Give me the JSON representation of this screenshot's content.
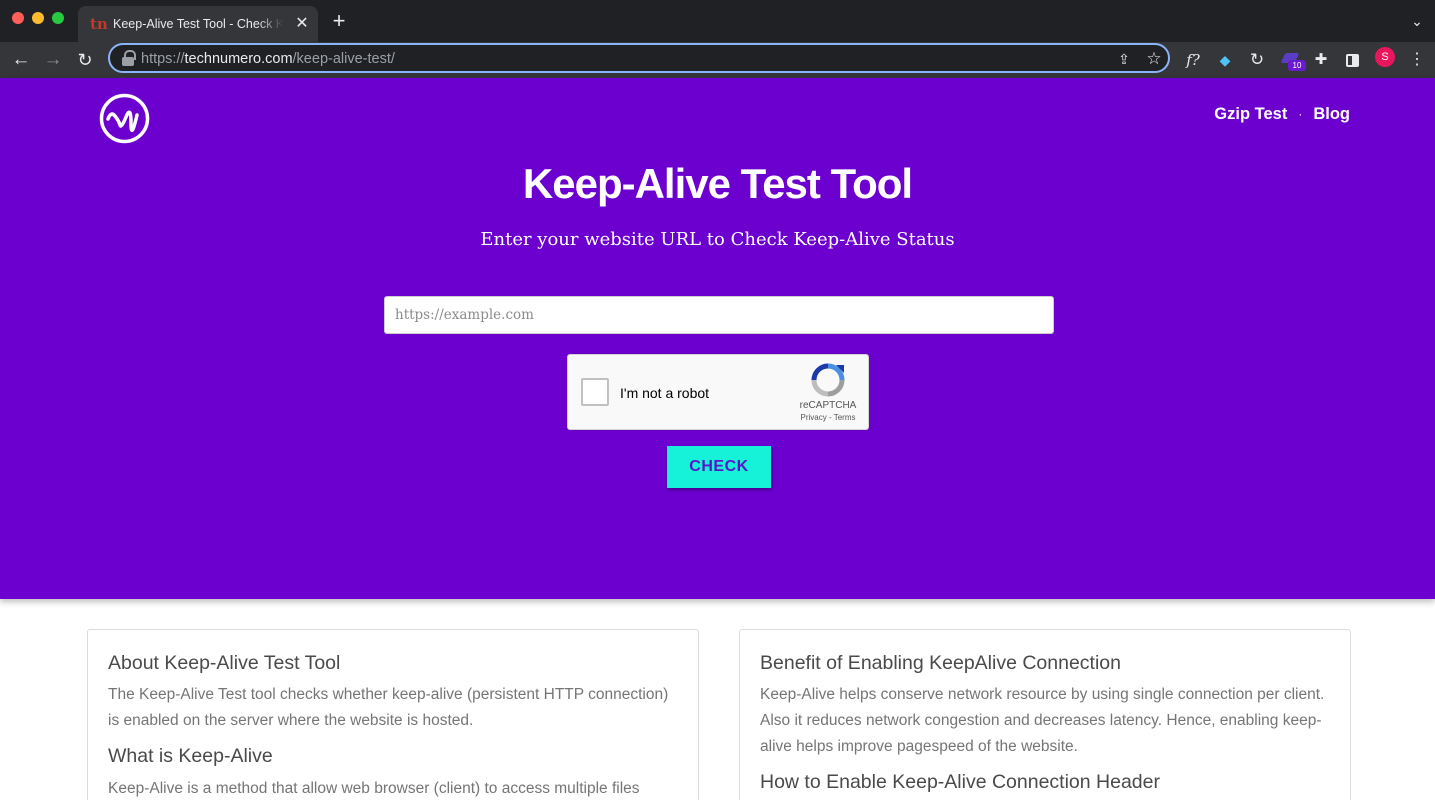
{
  "browser": {
    "tab_title": "Keep-Alive Test Tool - Check Keep-Alive Status",
    "favicon_text": "tn",
    "url": {
      "scheme": "https://",
      "host": "technumero.com",
      "path": "/keep-alive-test/"
    },
    "extension_badge_count": "10",
    "profile_initial": "S",
    "ext_f_label": "f?"
  },
  "header": {
    "nav": [
      {
        "label": "Gzip Test"
      },
      {
        "label": "Blog"
      }
    ],
    "separator": "·"
  },
  "hero": {
    "title": "Keep-Alive Test Tool",
    "subtitle": "Enter your website URL to Check Keep-Alive Status",
    "input_placeholder": "https://example.com",
    "check_label": "CHECK"
  },
  "recaptcha": {
    "label": "I'm not a robot",
    "brand": "reCAPTCHA",
    "links": "Privacy - Terms"
  },
  "cards": {
    "left": {
      "heading1": "About Keep-Alive Test Tool",
      "para1": "The Keep-Alive Test tool checks whether keep-alive (persistent HTTP connection) is enabled on the server where the website is hosted.",
      "heading2": "What is Keep-Alive",
      "para2": "Keep-Alive is a method that allow web browser (client) to access multiple files"
    },
    "right": {
      "heading1": "Benefit of Enabling KeepAlive Connection",
      "para1": "Keep-Alive helps conserve network resource by using single connection per client. Also it reduces network congestion and decreases latency. Hence, enabling keep-alive helps improve pagespeed of the website.",
      "heading2": "How to Enable Keep-Alive Connection Header"
    }
  },
  "colors": {
    "hero_bg": "#6c00cf",
    "check_bg": "#16f2d8",
    "check_text": "#5b14c7"
  }
}
